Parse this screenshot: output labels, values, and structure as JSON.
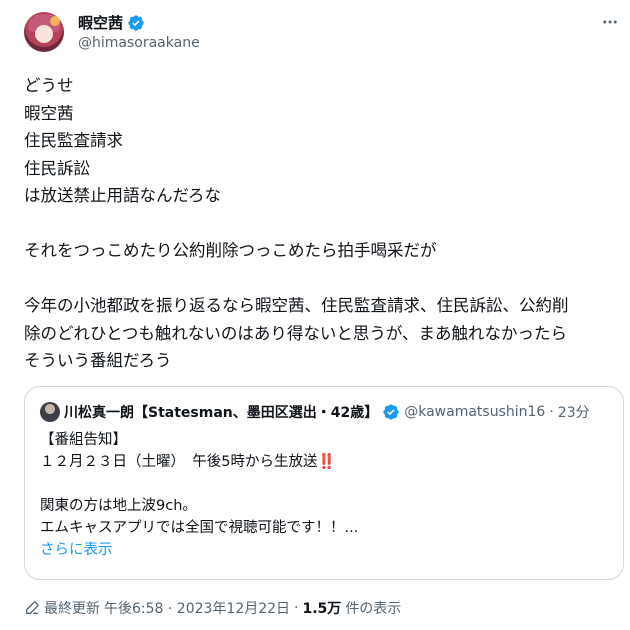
{
  "author": {
    "display_name": "暇空茜",
    "handle": "@himasoraakane"
  },
  "tweet": {
    "lines": [
      "どうせ",
      "暇空茜",
      "住民監査請求",
      "住民訴訟",
      "は放送禁止用語なんだろな",
      "",
      "それをつっこめたり公約削除つっこめたら拍手喝采だが",
      "",
      "今年の小池都政を振り返るなら暇空茜、住民監査請求、住民訴訟、公約削",
      "除のどれひとつも触れないのはあり得ないと思うが、まあ触れなかったら",
      "そういう番組だろう"
    ]
  },
  "quote": {
    "display_name": "川松真一朗【Statesman、墨田区選出・42歳】",
    "handle": "@kawamatsushin16",
    "separator": "·",
    "time": "23分",
    "line1": "【番組告知】",
    "line2_text": "１２月２３日（土曜）　午後5時から生放送",
    "line2_emoji": "‼️",
    "line3": "関東の方は地上波9ch。",
    "line4": "エムキャスアプリでは全国で視聴可能です！！...",
    "show_more": "さらに表示"
  },
  "meta": {
    "edited_label": "最終更新",
    "timestamp": "午後6:58 · 2023年12月22日",
    "separator": "·",
    "views_count": "1.5万",
    "views_label": "件の表示"
  },
  "colors": {
    "text": "#0f1419",
    "secondary": "#536471",
    "link": "#1d9bf0",
    "verified": "#1d9bf0",
    "border": "#cfd9de"
  },
  "icons": {
    "verified": "verified-badge-icon",
    "more": "more-dots-icon",
    "edit": "edit-pencil-icon"
  }
}
